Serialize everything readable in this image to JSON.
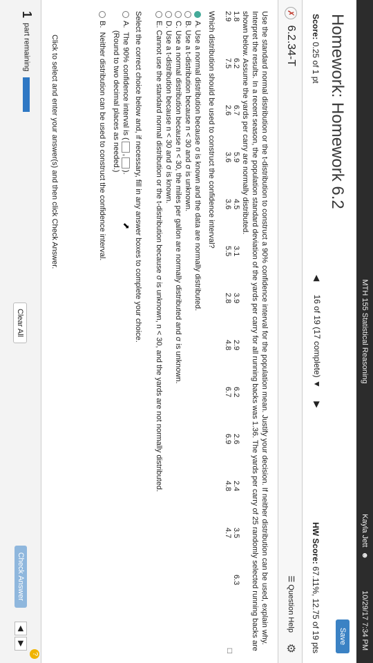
{
  "topbar": {
    "course": "MTH 155 Statistical Reasoning",
    "user": "Kayla Jett",
    "datetime": "10/29/17 7:34 PM"
  },
  "header": {
    "title": "Homework: Homework 6.2",
    "score_label": "Score:",
    "score_value": "0.25 of 1 pt",
    "save_label": "Save",
    "hw_score_label": "HW Score:",
    "hw_score_value": "67.11%, 12.75 of 19 pts",
    "navigation": "16 of 19 (17 complete)"
  },
  "question": {
    "id": "6.2.34-T",
    "help_label": "Question Help",
    "prompt": "Use the standard normal distribution or the t-distribution to construct a 90% confidence interval for the population mean. Justify your decision. If neither distribution can be used, explain why. Interpret the results. In a recent season, the population standard deviation of the yards per carry for all running backs was 1.36. The yards per carry of 25 randomly selected running backs are shown below. Assume the yards per carry are normally distributed.",
    "data_rows": [
      [
        "1.8",
        "6.2",
        "6.7",
        "5.9",
        "4.5",
        "3.1",
        "3.9",
        "2.9",
        "6.2",
        "2.6",
        "2.4",
        "3.5",
        "6.3"
      ],
      [
        "2.9",
        "7.5",
        "2.6",
        "3.6",
        "3.6",
        "5.5",
        "2.8",
        "4.8",
        "6.7",
        "6.9",
        "4.8",
        "4.7"
      ]
    ],
    "subquestion": "Which distribution should be used to construct the confidence interval?",
    "options": [
      "A.  Use a normal distribution because σ is known and the data are normally distributed.",
      "B.  Use a t-distribution because n < 30 and σ is unknown.",
      "C.  Use a normal distribution because n < 30, the miles per gallon are normally distributed and σ is unknown.",
      "D.  Use a t-distribution because n < 30 and σ is known.",
      "E.  Cannot use the standard normal distribution or the t-distribution because σ is unknown, n < 30, and the yards are not normally distributed."
    ],
    "select_instruction": "Select the correct choice below and, if necessary, fill in any answer boxes to complete your choice.",
    "choice_a_line1": "The 90% confidence interval is (",
    "choice_a_line2": "(Round to two decimal places as needed.)",
    "choice_b": "Neither distribution can be used to construct the confidence interval."
  },
  "footer": {
    "instruction": "Click to select and enter your answer(s) and then click Check Answer.",
    "parts_number": "1",
    "parts_label": "part remaining",
    "clear_label": "Clear All",
    "check_label": "Check Answer"
  }
}
